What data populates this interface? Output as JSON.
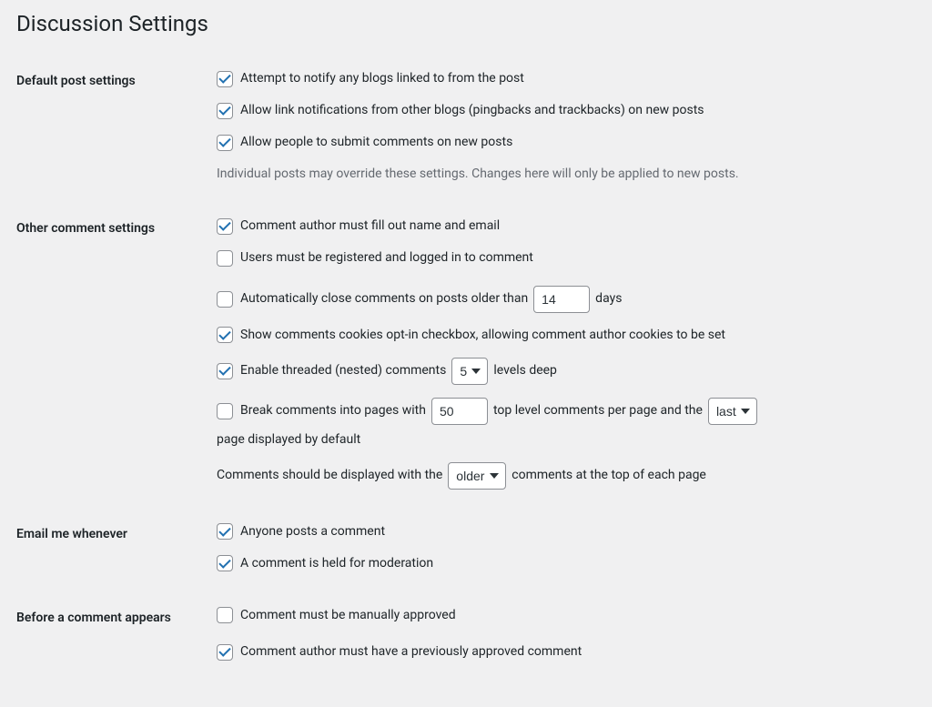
{
  "page": {
    "title": "Discussion Settings"
  },
  "sections": {
    "default_post": {
      "heading": "Default post settings",
      "notify": "Attempt to notify any blogs linked to from the post",
      "pingbacks": "Allow link notifications from other blogs (pingbacks and trackbacks) on new posts",
      "allow_comments": "Allow people to submit comments on new posts",
      "note": "Individual posts may override these settings. Changes here will only be applied to new posts."
    },
    "other": {
      "heading": "Other comment settings",
      "fill_name_email": "Comment author must fill out name and email",
      "must_register": "Users must be registered and logged in to comment",
      "auto_close_pre": "Automatically close comments on posts older than",
      "auto_close_value": "14",
      "auto_close_post": "days",
      "cookies_optin": "Show comments cookies opt-in checkbox, allowing comment author cookies to be set",
      "threaded_pre": "Enable threaded (nested) comments",
      "threaded_value": "5",
      "threaded_post": "levels deep",
      "paginate_pre": "Break comments into pages with",
      "paginate_value": "50",
      "paginate_mid": "top level comments per page and the",
      "paginate_default": "last",
      "paginate_post": "page displayed by default",
      "order_pre": "Comments should be displayed with the",
      "order_value": "older",
      "order_post": "comments at the top of each page"
    },
    "email": {
      "heading": "Email me whenever",
      "anyone_posts": "Anyone posts a comment",
      "held_moderation": "A comment is held for moderation"
    },
    "before": {
      "heading": "Before a comment appears",
      "manual_approve": "Comment must be manually approved",
      "prev_approved": "Comment author must have a previously approved comment"
    }
  }
}
